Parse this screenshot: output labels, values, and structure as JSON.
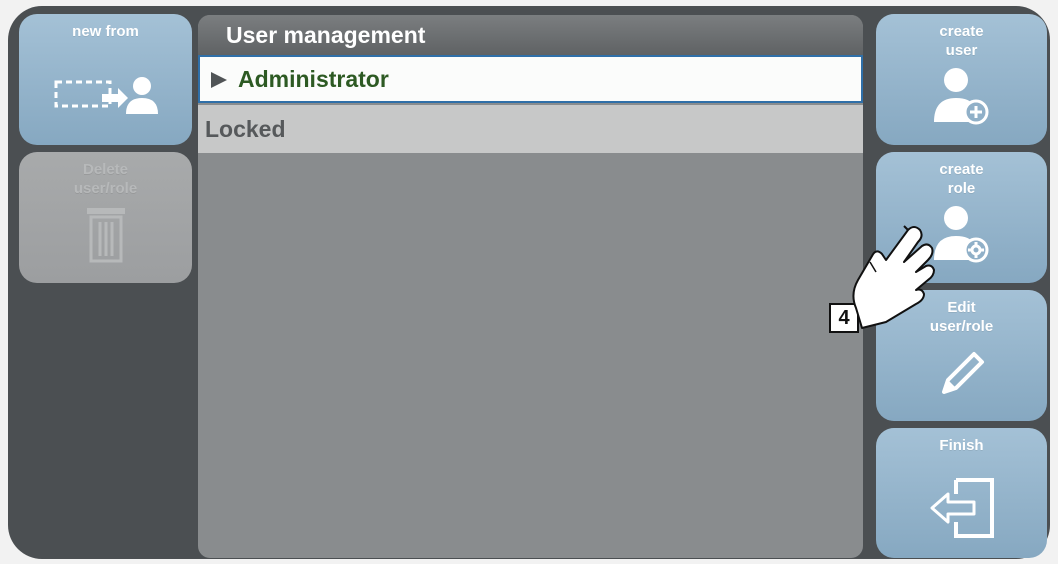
{
  "left_buttons": {
    "new_from": "new from",
    "delete": "Delete\nuser/role"
  },
  "panel": {
    "title": "User management",
    "items": [
      {
        "label": "Administrator",
        "selected": true
      },
      {
        "label": "Locked",
        "selected": false
      }
    ]
  },
  "right_buttons": {
    "create_user": "create\nuser",
    "create_role": "create\nrole",
    "edit": "Edit\nuser/role",
    "finish": "Finish"
  },
  "callout": {
    "step": "4"
  },
  "colors": {
    "button": "#94b4cb",
    "button_disabled": "#a3a5a6",
    "frame": "#4b4f52",
    "panel": "#898c8e",
    "selected_text": "#2d5a23",
    "selected_border": "#2f6fa8"
  },
  "icons": {
    "new_from": "copy-to-user-icon",
    "delete": "trash-icon",
    "create_user": "user-add-icon",
    "create_role": "user-role-icon",
    "edit": "pencil-icon",
    "finish": "exit-icon",
    "pointer": "pointing-hand-icon"
  }
}
